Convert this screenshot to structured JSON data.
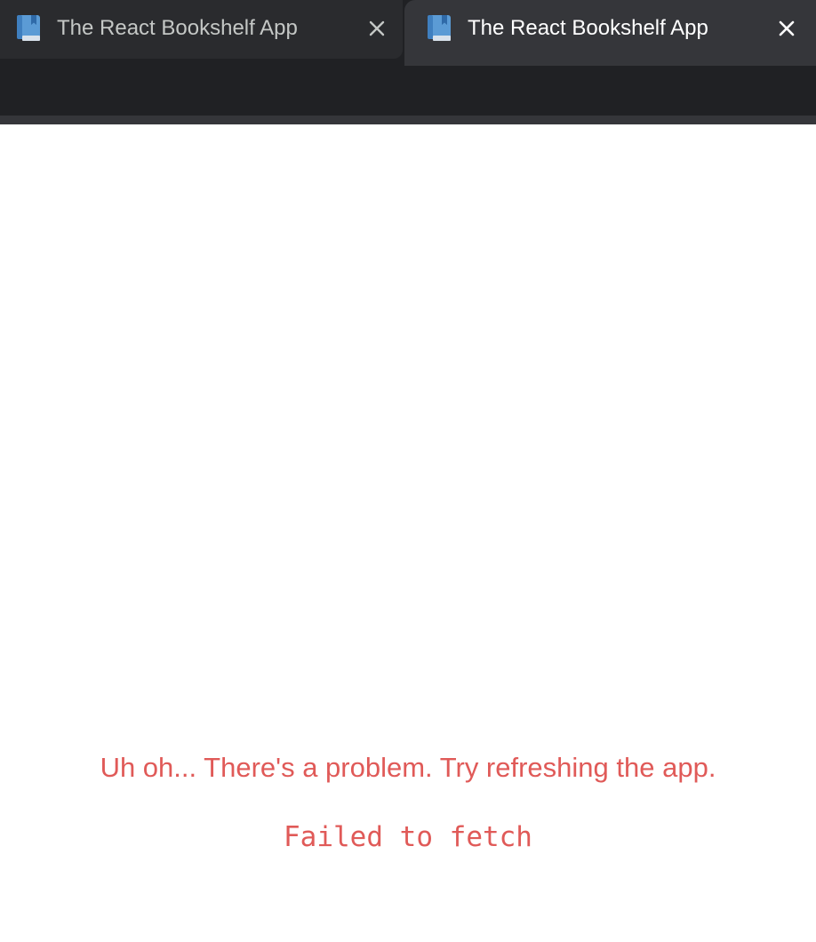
{
  "tabs": [
    {
      "title": "The React Bookshelf App",
      "active": false,
      "favicon": "book-icon"
    },
    {
      "title": "The React Bookshelf App",
      "active": true,
      "favicon": "book-icon"
    }
  ],
  "page": {
    "error_message": "Uh oh... There's a problem. Try refreshing the app.",
    "error_detail": "Failed to fetch"
  },
  "colors": {
    "chrome_bg": "#202124",
    "active_tab_bg": "#35363a",
    "error_text": "#e05a58",
    "favicon_blue": "#5b9bd5"
  }
}
